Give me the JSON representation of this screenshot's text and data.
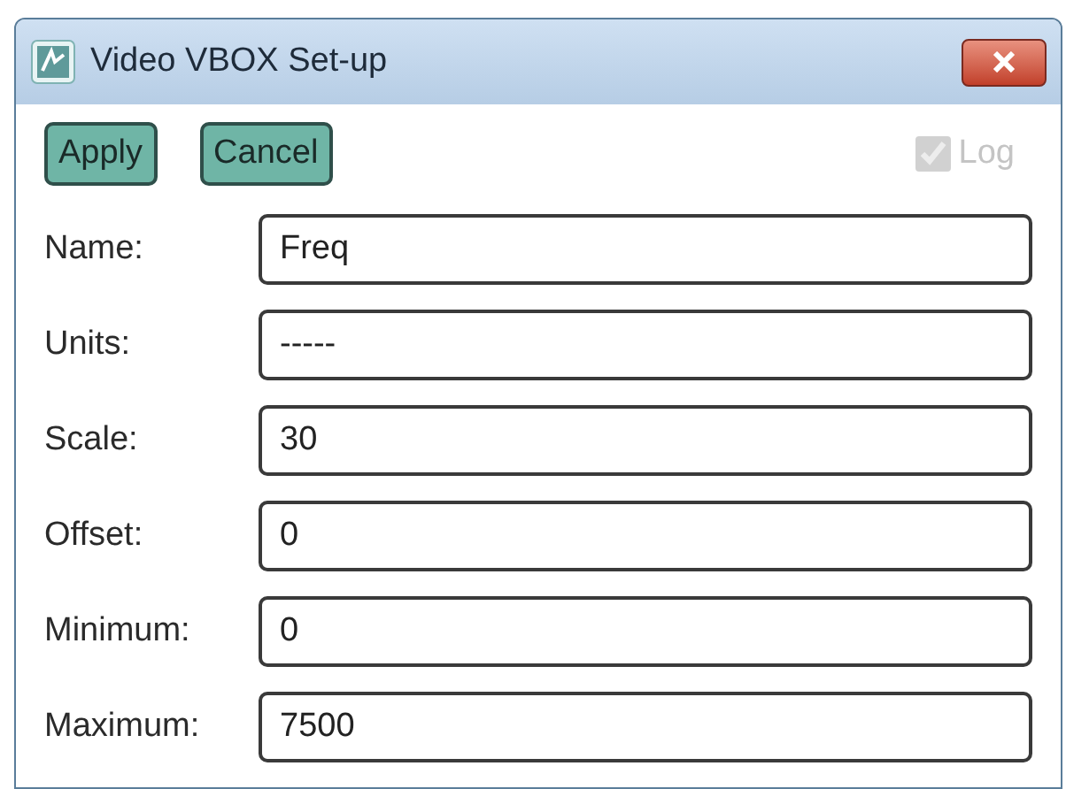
{
  "window": {
    "title": "Video VBOX Set-up"
  },
  "buttons": [
    "Apply",
    "Cancel"
  ],
  "log": {
    "label": "Log",
    "checked": true,
    "disabled": true
  },
  "fields": [
    {
      "label": "Name:",
      "value": "Freq"
    },
    {
      "label": "Units:",
      "value": "-----"
    },
    {
      "label": "Scale:",
      "value": "30"
    },
    {
      "label": "Offset:",
      "value": "0"
    },
    {
      "label": "Minimum:",
      "value": "0"
    },
    {
      "label": "Maximum:",
      "value": "7500"
    }
  ]
}
